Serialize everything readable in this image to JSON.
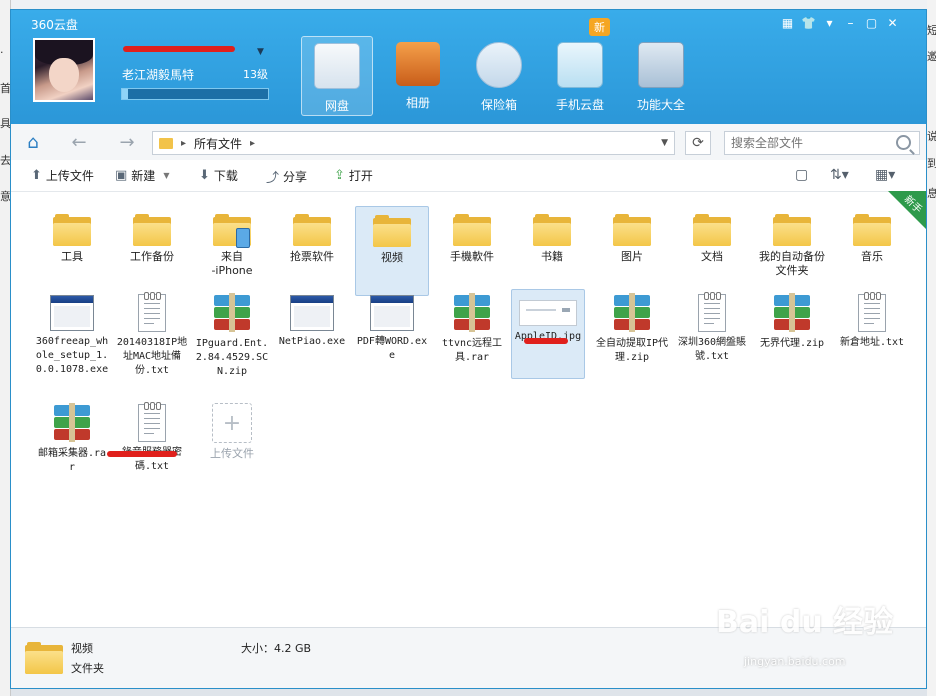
{
  "app": {
    "title": "360云盘",
    "user_name": "老江湖毅馬特",
    "user_level": "13级",
    "quota_fraction": 0.04
  },
  "nav": [
    {
      "label": "网盘",
      "icon": "cloud-disk-icon",
      "active": true
    },
    {
      "label": "相册",
      "icon": "photo-album-icon",
      "active": false
    },
    {
      "label": "保险箱",
      "icon": "safe-icon",
      "active": false
    },
    {
      "label": "手机云盘",
      "icon": "mobile-cloud-icon",
      "active": false
    },
    {
      "label": "功能大全",
      "icon": "toolbox-icon",
      "active": false
    }
  ],
  "badge_new": "新",
  "address": {
    "crumb": "所有文件",
    "search_placeholder": "搜索全部文件"
  },
  "toolbar": {
    "upload": "上传文件",
    "new": "新建",
    "download": "下载",
    "share": "分享",
    "open": "打开"
  },
  "corner_tag": "新手",
  "files": [
    {
      "name": "工具",
      "type": "folder"
    },
    {
      "name": "工作备份",
      "type": "folder"
    },
    {
      "name": "来自\n-iPhone",
      "type": "folder-phone"
    },
    {
      "name": "抢票软件",
      "type": "folder"
    },
    {
      "name": "视频",
      "type": "folder",
      "selected": true
    },
    {
      "name": "手機軟件",
      "type": "folder"
    },
    {
      "name": "书籍",
      "type": "folder"
    },
    {
      "name": "图片",
      "type": "folder"
    },
    {
      "name": "文档",
      "type": "folder"
    },
    {
      "name": "我的自动备份文件夹",
      "type": "folder"
    },
    {
      "name": "音乐",
      "type": "folder"
    },
    {
      "name": "360freeap_whole_setup_1.0.0.1078.exe",
      "type": "exe"
    },
    {
      "name": "20140318IP地址MAC地址備份.txt",
      "type": "txt"
    },
    {
      "name": "IPguard.Ent.2.84.4529.SCN.zip",
      "type": "rar"
    },
    {
      "name": "NetPiao.exe",
      "type": "exe"
    },
    {
      "name": "PDF轉WORD.exe",
      "type": "exe"
    },
    {
      "name": "ttvnc远程工具.rar",
      "type": "rar"
    },
    {
      "name": "AppleID.jpg",
      "type": "jpg",
      "selected": true
    },
    {
      "name": "全自动提取IP代理.zip",
      "type": "rar"
    },
    {
      "name": "深圳360網盤賬號.txt",
      "type": "txt"
    },
    {
      "name": "无界代理.zip",
      "type": "rar"
    },
    {
      "name": "新倉地址.txt",
      "type": "txt"
    },
    {
      "name": "邮箱采集器.rar",
      "type": "rar"
    },
    {
      "name": "錄音服務器密碼.txt",
      "type": "txt"
    },
    {
      "name": "上传文件",
      "type": "upload"
    }
  ],
  "status": {
    "name": "视频",
    "type": "文件夹",
    "size": "大小：4.2 GB"
  },
  "watermark": {
    "brand": "Bai du 经验",
    "url": "jingyan.baidu.com"
  }
}
